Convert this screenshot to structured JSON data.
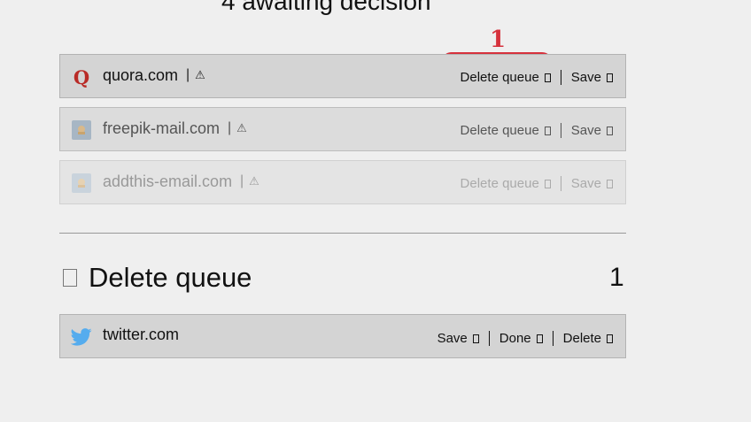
{
  "heading": "4 awaiting decision",
  "annotation": {
    "number": "1",
    "color": "#d6313c"
  },
  "pending_rows": [
    {
      "domain": "quora.com",
      "separator": "|",
      "warn_icon": "⚠",
      "favicon": "quora-logo-icon",
      "delete_label": "Delete queue",
      "save_label": "Save"
    },
    {
      "domain": "freepik-mail.com",
      "separator": "|",
      "warn_icon": "⚠",
      "favicon": "generic-site-icon",
      "delete_label": "Delete queue",
      "save_label": "Save"
    },
    {
      "domain": "addthis-email.com",
      "separator": "|",
      "warn_icon": "⚠",
      "favicon": "generic-site-icon",
      "delete_label": "Delete queue",
      "save_label": "Save"
    }
  ],
  "delete_queue": {
    "title": "Delete queue",
    "count": "1",
    "rows": [
      {
        "domain": "twitter.com",
        "favicon": "twitter-bird-icon",
        "save_label": "Save",
        "done_label": "Done",
        "delete_label": "Delete"
      }
    ]
  },
  "colors": {
    "background": "#efefef",
    "row": "#d4d4d4",
    "twitter": "#1da1f2",
    "quora": "#b92b27"
  }
}
